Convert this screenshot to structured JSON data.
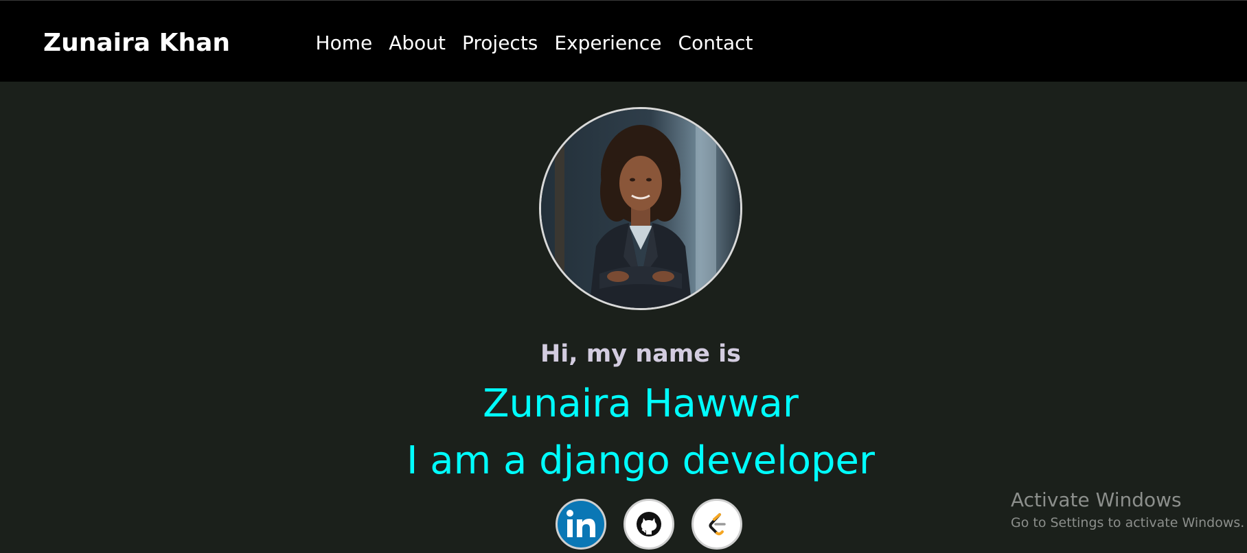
{
  "navbar": {
    "brand": "Zunaira Khan",
    "links": [
      "Home",
      "About",
      "Projects",
      "Experience",
      "Contact"
    ]
  },
  "hero": {
    "greeting": "Hi, my name is",
    "name": "Zunaira Hawwar",
    "role": "I am a django developer"
  },
  "socials": [
    {
      "icon": "linkedin-icon"
    },
    {
      "icon": "github-icon"
    },
    {
      "icon": "leetcode-icon"
    }
  ],
  "watermark": {
    "title": "Activate Windows",
    "subtitle": "Go to Settings to activate Windows."
  },
  "colors": {
    "background": "#1b201b",
    "navbar": "#000000",
    "accent": "#00ffff",
    "greeting": "#d3cce0",
    "linkedin": "#0a77b5"
  }
}
